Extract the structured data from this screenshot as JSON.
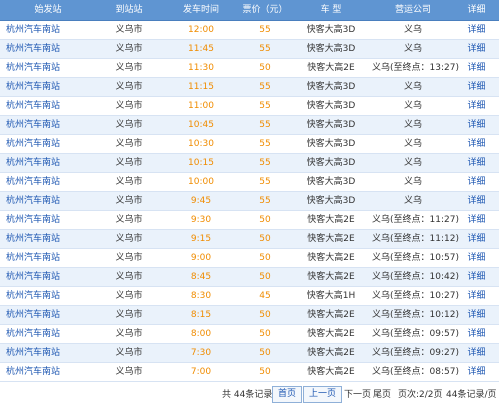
{
  "header": {
    "col1": "始发站",
    "col2": "到站站",
    "col3": "发车时间",
    "col4": "票价（元）",
    "col5": "车 型",
    "col6": "营运公司",
    "col7": "详细"
  },
  "rows": [
    {
      "origin": "杭州汽车南站",
      "dest": "义乌市",
      "time": "12:00",
      "price": "55",
      "vehicle": "快客大高3D",
      "company": "义乌",
      "detail": "详细"
    },
    {
      "origin": "杭州汽车南站",
      "dest": "义乌市",
      "time": "11:45",
      "price": "55",
      "vehicle": "快客大高3D",
      "company": "义乌",
      "detail": "详细"
    },
    {
      "origin": "杭州汽车南站",
      "dest": "义乌市",
      "time": "11:30",
      "price": "50",
      "vehicle": "快客大高2E",
      "company": "义乌(至终点：13:27)",
      "detail": "详细"
    },
    {
      "origin": "杭州汽车南站",
      "dest": "义乌市",
      "time": "11:15",
      "price": "55",
      "vehicle": "快客大高3D",
      "company": "义乌",
      "detail": "详细"
    },
    {
      "origin": "杭州汽车南站",
      "dest": "义乌市",
      "time": "11:00",
      "price": "55",
      "vehicle": "快客大高3D",
      "company": "义乌",
      "detail": "详细"
    },
    {
      "origin": "杭州汽车南站",
      "dest": "义乌市",
      "time": "10:45",
      "price": "55",
      "vehicle": "快客大高3D",
      "company": "义乌",
      "detail": "详细"
    },
    {
      "origin": "杭州汽车南站",
      "dest": "义乌市",
      "time": "10:30",
      "price": "55",
      "vehicle": "快客大高3D",
      "company": "义乌",
      "detail": "详细"
    },
    {
      "origin": "杭州汽车南站",
      "dest": "义乌市",
      "time": "10:15",
      "price": "55",
      "vehicle": "快客大高3D",
      "company": "义乌",
      "detail": "详细"
    },
    {
      "origin": "杭州汽车南站",
      "dest": "义乌市",
      "time": "10:00",
      "price": "55",
      "vehicle": "快客大高3D",
      "company": "义乌",
      "detail": "详细"
    },
    {
      "origin": "杭州汽车南站",
      "dest": "义乌市",
      "time": "9:45",
      "price": "55",
      "vehicle": "快客大高3D",
      "company": "义乌",
      "detail": "详细"
    },
    {
      "origin": "杭州汽车南站",
      "dest": "义乌市",
      "time": "9:30",
      "price": "50",
      "vehicle": "快客大高2E",
      "company": "义乌(至终点：11:27)",
      "detail": "详细"
    },
    {
      "origin": "杭州汽车南站",
      "dest": "义乌市",
      "time": "9:15",
      "price": "50",
      "vehicle": "快客大高2E",
      "company": "义乌(至终点：11:12)",
      "detail": "详细"
    },
    {
      "origin": "杭州汽车南站",
      "dest": "义乌市",
      "time": "9:00",
      "price": "50",
      "vehicle": "快客大高2E",
      "company": "义乌(至终点：10:57)",
      "detail": "详细"
    },
    {
      "origin": "杭州汽车南站",
      "dest": "义乌市",
      "time": "8:45",
      "price": "50",
      "vehicle": "快客大高2E",
      "company": "义乌(至终点：10:42)",
      "detail": "详细"
    },
    {
      "origin": "杭州汽车南站",
      "dest": "义乌市",
      "time": "8:30",
      "price": "45",
      "vehicle": "快客大高1H",
      "company": "义乌(至终点：10:27)",
      "detail": "详细"
    },
    {
      "origin": "杭州汽车南站",
      "dest": "义乌市",
      "time": "8:15",
      "price": "50",
      "vehicle": "快客大高2E",
      "company": "义乌(至终点：10:12)",
      "detail": "详细"
    },
    {
      "origin": "杭州汽车南站",
      "dest": "义乌市",
      "time": "8:00",
      "price": "50",
      "vehicle": "快客大高2E",
      "company": "义乌(至终点：09:57)",
      "detail": "详细"
    },
    {
      "origin": "杭州汽车南站",
      "dest": "义乌市",
      "time": "7:30",
      "price": "50",
      "vehicle": "快客大高2E",
      "company": "义乌(至终点：09:27)",
      "detail": "详细"
    },
    {
      "origin": "杭州汽车南站",
      "dest": "义乌市",
      "time": "7:00",
      "price": "50",
      "vehicle": "快客大高2E",
      "company": "义乌(至终点：08:57)",
      "detail": "详细"
    }
  ],
  "pager": {
    "total": "共 44条记录",
    "first": "首页",
    "prev": "上一页",
    "next": "下一页",
    "last": "尾页",
    "pageinfo": "页次:2/2页",
    "perpage": "44条记录/页"
  },
  "colors": {
    "header_bg": "#5f95d2",
    "row_alt_bg": "#eaf2fb",
    "row_bg": "#ffffff",
    "time_price": "#f08c00",
    "link": "#1e57b2"
  }
}
